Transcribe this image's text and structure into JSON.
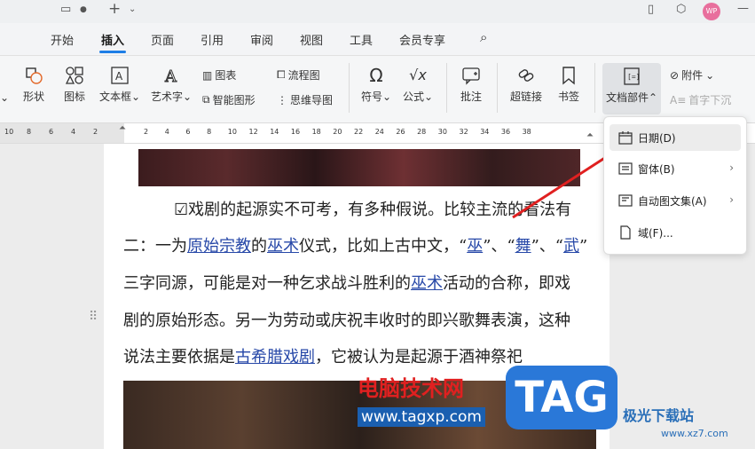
{
  "menubar": {
    "tabs": [
      "开始",
      "插入",
      "页面",
      "引用",
      "审阅",
      "视图",
      "工具",
      "会员专享"
    ],
    "active_tab": "插入"
  },
  "titlebar": {
    "avatar_text": "WP"
  },
  "ribbon": {
    "shape": "形状",
    "icon": "图标",
    "textbox": "文本框",
    "wordart": "艺术字",
    "chart": "图表",
    "smartart": "智能图形",
    "flowchart": "流程图",
    "mindmap": "思维导图",
    "symbol": "符号",
    "formula": "公式",
    "comment": "批注",
    "hyperlink": "超链接",
    "bookmark": "书签",
    "docparts": "文档部件",
    "attachment": "附件",
    "dropcap": "首字下沉"
  },
  "ruler": {
    "numbers": [
      "10",
      "8",
      "6",
      "4",
      "2",
      "2",
      "4",
      "6",
      "8",
      "10",
      "12",
      "14",
      "16",
      "18",
      "20",
      "22",
      "24",
      "26",
      "28",
      "30",
      "32",
      "34",
      "36",
      "38"
    ]
  },
  "document": {
    "line1": "☑戏剧的起源实不可考，有多种假说。比较主流的看法有",
    "line2": {
      "a": "二：一为",
      "l1": "原始宗教",
      "b": "的",
      "l2": "巫术",
      "c": "仪式，比如上古中文，“",
      "l3": "巫",
      "d": "”、“",
      "l4": "舞",
      "e": "”、“",
      "l5": "武",
      "f": "”"
    },
    "line3": {
      "a": "三字同源，可能是对一种乞求战斗胜利的",
      "l1": "巫术",
      "b": "活动的合称，即戏"
    },
    "line4": "剧的原始形态。另一为劳动或庆祝丰收时的即兴歌舞表演，这种",
    "line5": {
      "a": "说法主要依据是",
      "l1": "古希腊戏剧",
      "b": "，它被认为是起源于酒神祭祀"
    }
  },
  "dropdown": {
    "items": [
      {
        "label": "日期(D)",
        "icon": "calendar-icon",
        "submenu": false
      },
      {
        "label": "窗体(B)",
        "icon": "form-icon",
        "submenu": true
      },
      {
        "label": "自动图文集(A)",
        "icon": "autotext-icon",
        "submenu": true
      },
      {
        "label": "域(F)...",
        "icon": "field-icon",
        "submenu": false
      }
    ]
  },
  "watermark": {
    "title": "电脑技术网",
    "url": "www.tagxp.com",
    "tag": "TAG",
    "site_name": "极光下载站",
    "site_url": "www.xz7.com"
  },
  "colors": {
    "accent": "#1e7ee6",
    "link": "#2748a8",
    "arrow": "#e02020"
  }
}
